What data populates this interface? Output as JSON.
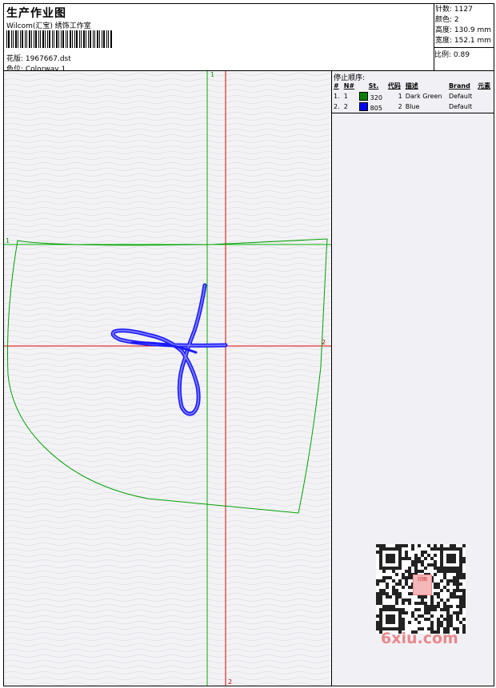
{
  "header": {
    "title": "生产作业图",
    "company": "Wilcom(汇宝) 绣饰工作室",
    "design_label": "花版: 1967667.dst",
    "colorway_label": "色位: Colorway 1"
  },
  "stats": {
    "stitches": "针数: 1127",
    "colors": "颜色: 2",
    "height": "高度: 130.9 mm",
    "width": "宽度: 152.1 mm",
    "scale": "比例: 0.89"
  },
  "design": {
    "guide_green_v_label": "1",
    "guide_green_h_label": "1",
    "guide_red_h_label": "2",
    "guide_red_v_label": "2",
    "colors": {
      "outline": "#00a000",
      "stitch": "#1a1aff",
      "guide_red": "#e00000",
      "guide_green": "#00b000"
    }
  },
  "sidepanel": {
    "stop_title": "停止顺序:",
    "columns": [
      "#",
      "N#",
      "St.",
      "代码",
      "描述",
      "Brand",
      "元素"
    ],
    "rows": [
      {
        "num": "1.",
        "n": "1",
        "swatch": "#008000",
        "st": "320",
        "code": "1",
        "desc": "Dark Green",
        "brand": "Default"
      },
      {
        "num": "2.",
        "n": "2",
        "swatch": "#0000ff",
        "st": "805",
        "code": "2",
        "desc": "Blue",
        "brand": "Default"
      }
    ]
  },
  "watermark": {
    "text": "6xiu.com",
    "badge": "印图"
  }
}
